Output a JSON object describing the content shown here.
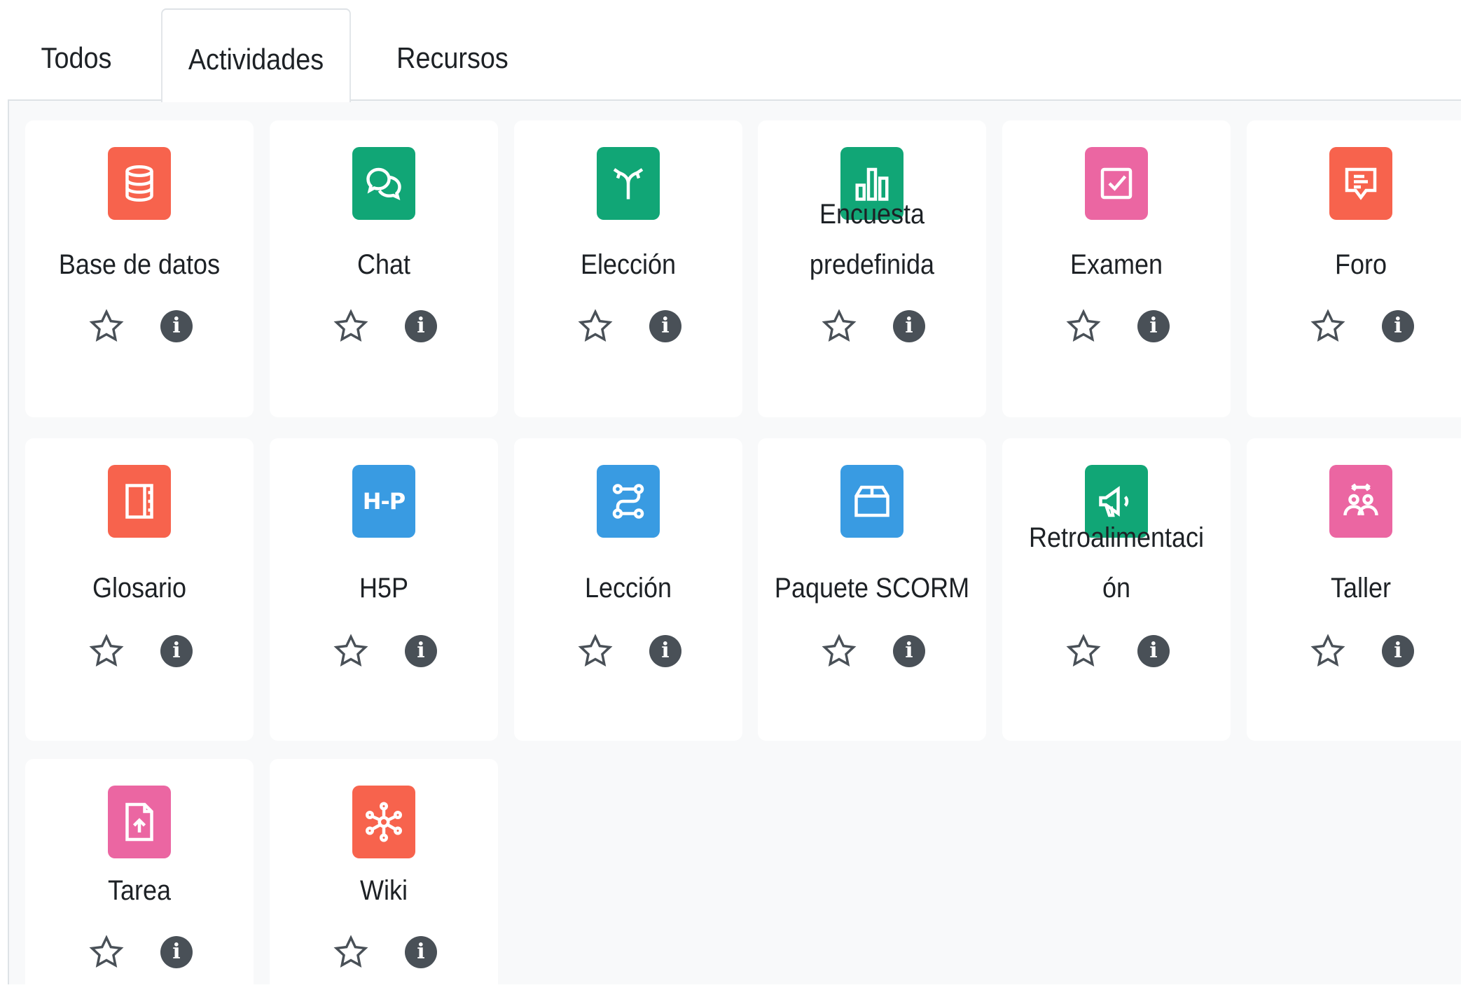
{
  "tabs": [
    {
      "label": "Todos"
    },
    {
      "label": "Actividades"
    },
    {
      "label": "Recursos"
    }
  ],
  "active_tab": "Actividades",
  "colors": {
    "orange": "#f7634d",
    "green": "#11a676",
    "pink": "#eb66a2",
    "blue": "#399be2",
    "info_badge": "#495057"
  },
  "modules": [
    {
      "lines": [
        "Base de datos"
      ],
      "icon": "database-icon",
      "color": "#f7634d"
    },
    {
      "lines": [
        "Chat"
      ],
      "icon": "chat-bubbles-icon",
      "color": "#11a676"
    },
    {
      "lines": [
        "Elección"
      ],
      "icon": "split-arrows-icon",
      "color": "#11a676"
    },
    {
      "lines": [
        "Encuesta",
        "predefinida"
      ],
      "icon": "bar-chart-icon",
      "color": "#11a676"
    },
    {
      "lines": [
        "Examen"
      ],
      "icon": "checkbox-icon",
      "color": "#eb66a2"
    },
    {
      "lines": [
        "Foro"
      ],
      "icon": "speech-bubble-icon",
      "color": "#f7634d"
    },
    {
      "lines": [
        "Glosario"
      ],
      "icon": "book-icon",
      "color": "#f7634d"
    },
    {
      "lines": [
        "H5P"
      ],
      "icon": "h5p-logo-icon",
      "color": "#399be2",
      "logo_text": "H-P"
    },
    {
      "lines": [
        "Lección"
      ],
      "icon": "path-route-icon",
      "color": "#399be2"
    },
    {
      "lines": [
        "Paquete SCORM"
      ],
      "icon": "package-box-icon",
      "color": "#399be2"
    },
    {
      "lines": [
        "Retroalimentaci",
        "ón"
      ],
      "icon": "megaphone-icon",
      "color": "#11a676"
    },
    {
      "lines": [
        "Taller"
      ],
      "icon": "workshop-people-icon",
      "color": "#eb66a2"
    },
    {
      "lines": [
        "Tarea"
      ],
      "icon": "file-upload-icon",
      "color": "#eb66a2"
    },
    {
      "lines": [
        "Wiki"
      ],
      "icon": "network-nodes-icon",
      "color": "#f7634d"
    }
  ],
  "info_glyph": "i"
}
